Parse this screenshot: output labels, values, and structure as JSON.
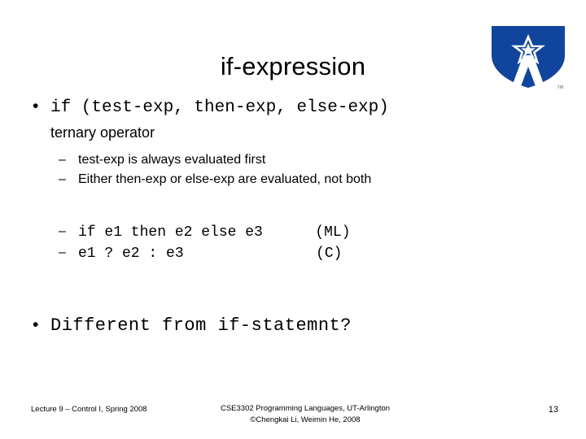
{
  "slide": {
    "title": "if-expression",
    "bullets": {
      "b1_marker": "•",
      "b1_code": "if (test-exp, then-exp, else-exp)",
      "b1_sub": "ternary operator",
      "b1_items": [
        {
          "marker": "–",
          "text": "test-exp is always evaluated first"
        },
        {
          "marker": "–",
          "text": "Either then-exp or else-exp are evaluated, not both"
        }
      ],
      "code_items": [
        {
          "marker": "–",
          "code": "if e1 then e2 else e3",
          "tag": "(ML)"
        },
        {
          "marker": "–",
          "code": "e1 ? e2 : e3",
          "tag": "(C)"
        }
      ],
      "b2_marker": "•",
      "b2_code": "Different from if-statemnt?"
    }
  },
  "logo": {
    "name": "uta-logo",
    "trademark": "TM",
    "shield_color": "#11449c",
    "star_color": "#ffffff",
    "letter": "A"
  },
  "footer": {
    "left": "Lecture 9 – Control I, Spring 2008",
    "center_line1": "CSE3302 Programming Languages, UT-Arlington",
    "center_line2": "©Chengkai Li, Weimin He, 2008",
    "page_number": "13"
  }
}
